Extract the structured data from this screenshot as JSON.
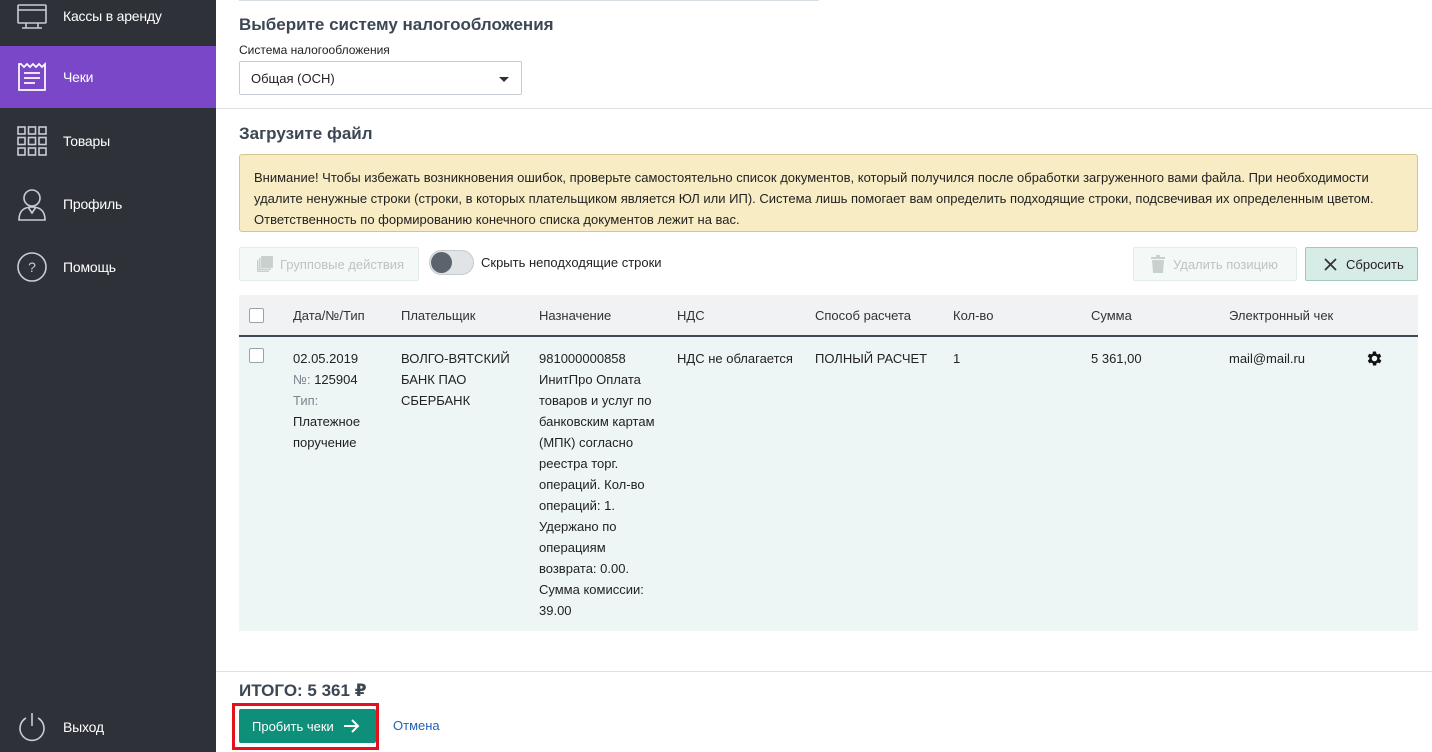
{
  "sidebar": {
    "items": [
      {
        "label": "Кассы в аренду",
        "icon": "rental-register-icon"
      },
      {
        "label": "Чеки",
        "icon": "receipt-icon"
      },
      {
        "label": "Товары",
        "icon": "products-grid-icon"
      },
      {
        "label": "Профиль",
        "icon": "profile-icon"
      },
      {
        "label": "Помощь",
        "icon": "help-icon"
      }
    ],
    "logout": "Выход"
  },
  "tax": {
    "heading": "Выберите систему налогообложения",
    "field_label": "Система налогообложения",
    "value": "Общая (ОСН)"
  },
  "upload": {
    "heading": "Загрузите файл",
    "warning": "Внимание! Чтобы избежать возникновения ошибок, проверьте самостоятельно список документов, который получился после обработки загруженного вами файла. При необходимости удалите ненужные строки (строки, в которых плательщиком является ЮЛ или ИП). Система лишь помогает вам определить подходящие строки, подсвечивая их определенным цветом. Ответственность по формированию конечного списка документов лежит на вас."
  },
  "toolbar": {
    "group_actions": "Групповые действия",
    "hide_rows": "Скрыть неподходящие строки",
    "delete_position": "Удалить позицию",
    "reset": "Сбросить"
  },
  "table": {
    "columns": [
      "Дата/№/Тип",
      "Плательщик",
      "Назначение",
      "НДС",
      "Способ расчета",
      "Кол-во",
      "Сумма",
      "Электронный чек"
    ],
    "rows": [
      {
        "date": "02.05.2019",
        "number_label": "№:",
        "number": "125904",
        "type_label": "Тип:",
        "type": "Платежное поручение",
        "payer": "ВОЛГО-ВЯТСКИЙ БАНК ПАО СБЕРБАНК",
        "purpose": "981000000858 ИнитПро Оплата товаров и услуг по банковским картам (МПК) согласно реестра торг. операций. Кол-во операций: 1. Удержано по операциям возврата: 0.00. Сумма комиссии: 39.00",
        "vat": "НДС не облагается",
        "method": "ПОЛНЫЙ РАСЧЕТ",
        "qty": "1",
        "sum": "5 361,00",
        "email": "mail@mail.ru"
      }
    ]
  },
  "footer": {
    "total": "ИТОГО: 5 361 ₽",
    "submit": "Пробить чеки",
    "cancel": "Отмена"
  },
  "colors": {
    "sidebar_bg": "#2e3138",
    "active_item": "#7b47c9",
    "primary_button": "#0e8f7a",
    "row_highlight": "#edf6f4",
    "warning_bg": "#f8ecc5",
    "annotation": "#e0121b"
  }
}
